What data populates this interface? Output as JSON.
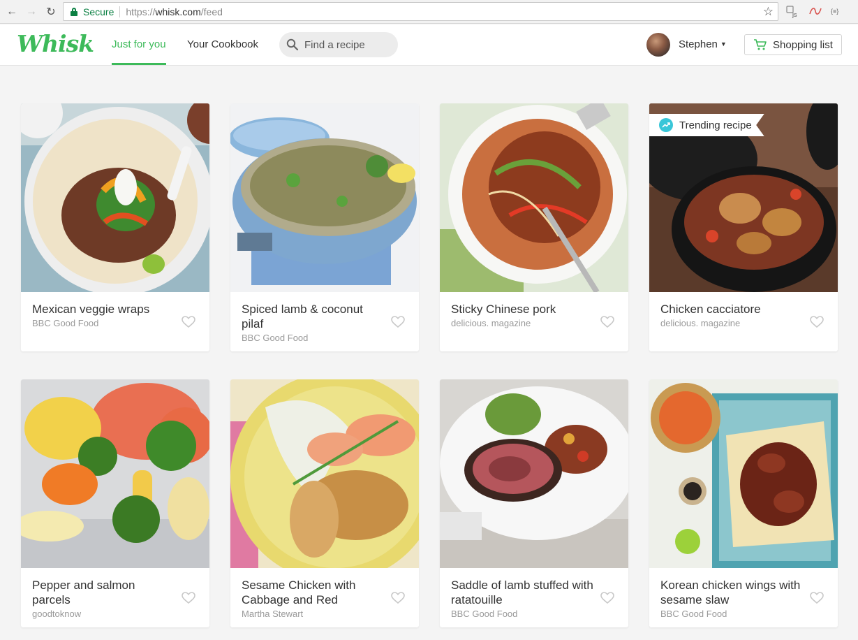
{
  "browser": {
    "secure_label": "Secure",
    "url_scheme": "https://",
    "url_host": "whisk.com",
    "url_path": "/feed",
    "ext_js": "js",
    "ext_json": "{≡}"
  },
  "app": {
    "logo_text": "Whisk",
    "brand_color": "#3dba5a",
    "nav": [
      {
        "label": "Just for you",
        "active": true
      },
      {
        "label": "Your Cookbook",
        "active": false
      }
    ],
    "search_placeholder": "Find a recipe",
    "user_name": "Stephen",
    "shopping_list_label": "Shopping list"
  },
  "badges": {
    "trending_label": "Trending recipe"
  },
  "recipes": [
    {
      "title": "Mexican veggie wraps",
      "source": "BBC Good Food",
      "image": "tortilla wrap with beans, peppers, sour cream and lime"
    },
    {
      "title": "Spiced lamb & coconut pilaf",
      "source": "BBC Good Food",
      "image": "blue casserole dish of rice pilaf with herbs"
    },
    {
      "title": "Sticky Chinese pork",
      "source": "delicious. magazine",
      "image": "bowl of glazed pork with noodles and chilli"
    },
    {
      "title": "Chicken cacciatore",
      "source": "delicious. magazine",
      "image": "black pot of chicken in tomato sauce"
    },
    {
      "title": "Pepper and salmon parcels",
      "source": "goodtoknow",
      "image": "salmon with broccoli, carrot and corn in foil"
    },
    {
      "title": "Sesame Chicken with Cabbage and Red",
      "source": "Martha Stewart",
      "image": "sesame-crusted chicken on yellow plate"
    },
    {
      "title": "Saddle of lamb stuffed with ratatouille",
      "source": "BBC Good Food",
      "image": "sliced lamb roll on white plate with salad"
    },
    {
      "title": "Korean chicken wings with sesame slaw",
      "source": "BBC Good Food",
      "image": "glazed wings on tortilla with slaw bowl"
    }
  ]
}
